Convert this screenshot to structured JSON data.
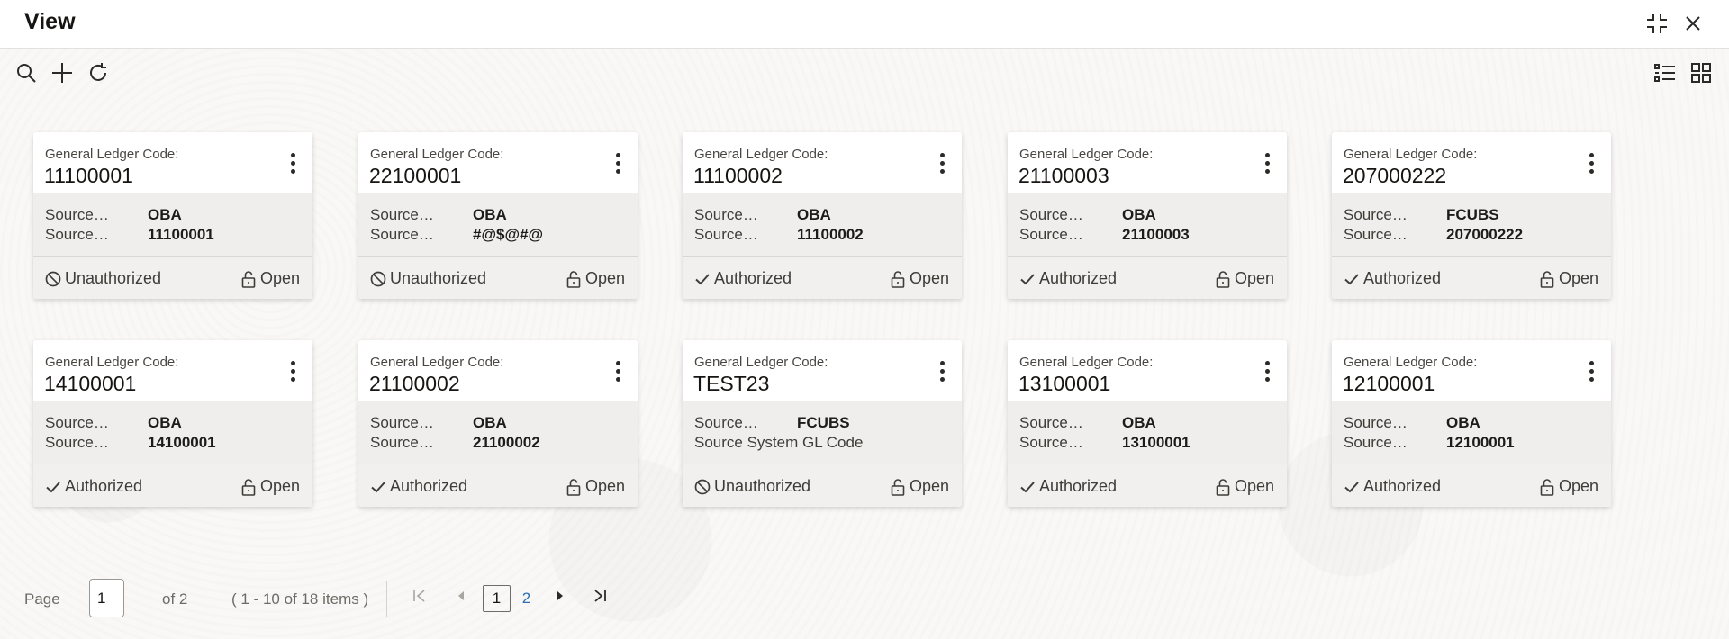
{
  "window": {
    "title": "View"
  },
  "icons": {
    "minimize": "collapse-arrows-icon",
    "close": "close-icon",
    "search": "search-icon",
    "add": "plus-icon",
    "refresh": "refresh-icon",
    "list_view": "list-view-icon",
    "grid_view": "grid-view-icon"
  },
  "cards": [
    {
      "label": "General Ledger Code:",
      "code": "11100001",
      "k1": "Source…",
      "v1": "OBA",
      "k2": "Source…",
      "v2": "11100001",
      "status": "Unauthorized",
      "status_kind": "unauthorized",
      "open": "Open"
    },
    {
      "label": "General Ledger Code:",
      "code": "22100001",
      "k1": "Source…",
      "v1": "OBA",
      "k2": "Source…",
      "v2": "#@$@#@",
      "status": "Unauthorized",
      "status_kind": "unauthorized",
      "open": "Open"
    },
    {
      "label": "General Ledger Code:",
      "code": "11100002",
      "k1": "Source…",
      "v1": "OBA",
      "k2": "Source…",
      "v2": "11100002",
      "status": "Authorized",
      "status_kind": "authorized",
      "open": "Open"
    },
    {
      "label": "General Ledger Code:",
      "code": "21100003",
      "k1": "Source…",
      "v1": "OBA",
      "k2": "Source…",
      "v2": "21100003",
      "status": "Authorized",
      "status_kind": "authorized",
      "open": "Open"
    },
    {
      "label": "General Ledger Code:",
      "code": "207000222",
      "k1": "Source…",
      "v1": "FCUBS",
      "k2": "Source…",
      "v2": "207000222",
      "status": "Authorized",
      "status_kind": "authorized",
      "open": "Open"
    },
    {
      "label": "General Ledger Code:",
      "code": "14100001",
      "k1": "Source…",
      "v1": "OBA",
      "k2": "Source…",
      "v2": "14100001",
      "status": "Authorized",
      "status_kind": "authorized",
      "open": "Open"
    },
    {
      "label": "General Ledger Code:",
      "code": "21100002",
      "k1": "Source…",
      "v1": "OBA",
      "k2": "Source…",
      "v2": "21100002",
      "status": "Authorized",
      "status_kind": "authorized",
      "open": "Open"
    },
    {
      "label": "General Ledger Code:",
      "code": "TEST23",
      "k1": "Source…",
      "v1": "FCUBS",
      "k2": "Source System GL Code",
      "v2": "",
      "status": "Unauthorized",
      "status_kind": "unauthorized",
      "open": "Open"
    },
    {
      "label": "General Ledger Code:",
      "code": "13100001",
      "k1": "Source…",
      "v1": "OBA",
      "k2": "Source…",
      "v2": "13100001",
      "status": "Authorized",
      "status_kind": "authorized",
      "open": "Open"
    },
    {
      "label": "General Ledger Code:",
      "code": "12100001",
      "k1": "Source…",
      "v1": "OBA",
      "k2": "Source…",
      "v2": "12100001",
      "status": "Authorized",
      "status_kind": "authorized",
      "open": "Open"
    }
  ],
  "pagination": {
    "page_label": "Page",
    "page_value": "1",
    "of_label": "of 2",
    "range_label": "( 1 - 10 of 18 items )",
    "pages": [
      "1",
      "2"
    ],
    "current_page": 1
  }
}
